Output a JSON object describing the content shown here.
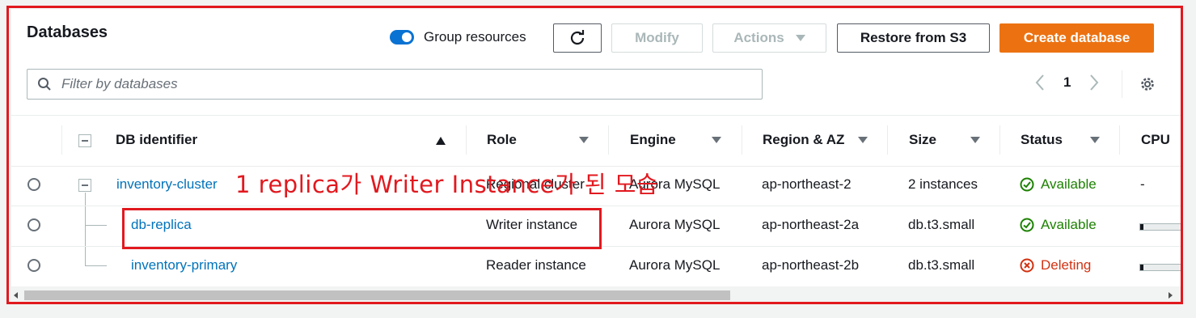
{
  "header": {
    "title": "Databases",
    "group_toggle_label": "Group resources",
    "modify_label": "Modify",
    "actions_label": "Actions",
    "restore_label": "Restore from S3",
    "create_label": "Create database"
  },
  "search": {
    "placeholder": "Filter by databases"
  },
  "pagination": {
    "page": "1"
  },
  "columns": [
    "DB identifier",
    "Role",
    "Engine",
    "Region & AZ",
    "Size",
    "Status",
    "CPU"
  ],
  "rows": [
    {
      "id": "inventory-cluster",
      "role": "Regional cluster",
      "engine": "Aurora MySQL",
      "region": "ap-northeast-2",
      "size": "2 instances",
      "status": "Available",
      "cpu": "-"
    },
    {
      "id": "db-replica",
      "role": "Writer instance",
      "engine": "Aurora MySQL",
      "region": "ap-northeast-2a",
      "size": "db.t3.small",
      "status": "Available",
      "cpu": ""
    },
    {
      "id": "inventory-primary",
      "role": "Reader instance",
      "engine": "Aurora MySQL",
      "region": "ap-northeast-2b",
      "size": "db.t3.small",
      "status": "Deleting",
      "cpu": ""
    }
  ],
  "annotation": "1 replica가 Writer Instance가 된 모습",
  "colors": {
    "accent": "#ec7211",
    "link": "#0073bb",
    "ok": "#1d8102",
    "error": "#d13212",
    "annotation": "#e1191f"
  },
  "icons": [
    "refresh-icon",
    "caret-down-icon",
    "search-icon",
    "chevron-left-icon",
    "chevron-right-icon",
    "gear-icon",
    "sort-ascending-icon",
    "sort-icon",
    "check-circle-icon",
    "x-circle-icon"
  ]
}
